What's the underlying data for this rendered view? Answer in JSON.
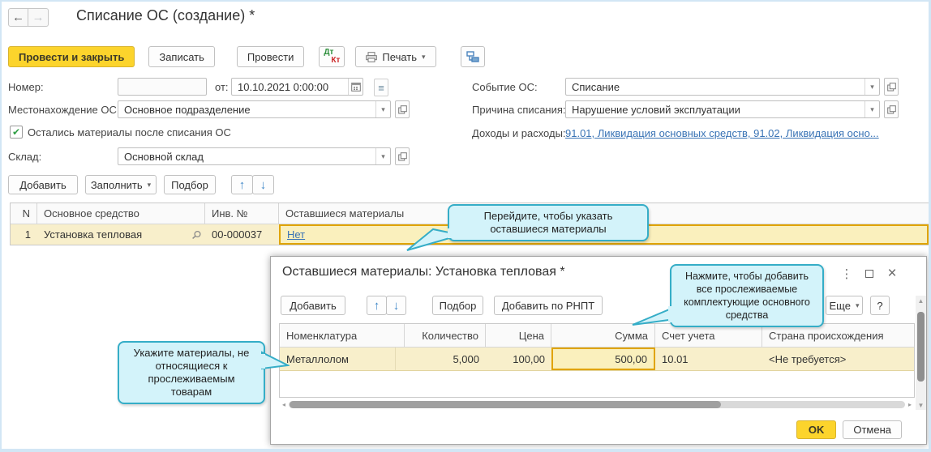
{
  "icons": {
    "back": "←",
    "forward": "→",
    "caret_down": "▾",
    "up_arrow": "↑",
    "down_arrow": "↓",
    "check": "✔",
    "dots": "⋮",
    "close": "×",
    "menu": "≡",
    "left_small": "◂",
    "right_small": "▸",
    "up_small": "▲",
    "down_small": "▼"
  },
  "window": {
    "title": "Списание ОС (создание) *"
  },
  "toolbar": {
    "post_close": "Провести и закрыть",
    "save": "Записать",
    "post": "Провести",
    "dt": "Дт",
    "kt": "Кт",
    "print": "Печать"
  },
  "form": {
    "number_label": "Номер:",
    "number_value": "",
    "date_label": "от:",
    "date_value": "10.10.2021 0:00:00",
    "location_label": "Местонахождение ОС:",
    "location_value": "Основное подразделение",
    "materials_checkbox_label": "Остались материалы после списания ОС",
    "warehouse_label": "Склад:",
    "warehouse_value": "Основной склад",
    "event_label": "Событие ОС:",
    "event_value": "Списание",
    "reason_label": "Причина списания:",
    "reason_value": "Нарушение условий эксплуатации",
    "income_label": "Доходы и расходы:",
    "income_value": "91.01, Ликвидация основных средств, 91.02, Ликвидация осно..."
  },
  "commands": {
    "add": "Добавить",
    "fill": "Заполнить",
    "pick": "Подбор"
  },
  "main_table": {
    "columns": [
      "N",
      "Основное средство",
      "Инв. №",
      "Оставшиеся материалы"
    ],
    "rows": [
      {
        "n": "1",
        "asset": "Установка тепловая",
        "inv": "00-000037",
        "materials": "Нет"
      }
    ]
  },
  "tooltips": {
    "goto": "Перейдите, чтобы указать оставшиеся материалы",
    "rnpt": "Нажмите, чтобы добавить все прослеживаемые комплектующие основного средства",
    "materials": "Укажите материалы, не относящиеся к прослеживаемым товарам"
  },
  "modal": {
    "title": "Оставшиеся материалы: Установка тепловая *",
    "commands": {
      "add": "Добавить",
      "pick": "Подбор",
      "add_rnpt": "Добавить по РНПТ",
      "more": "Еще",
      "help": "?"
    },
    "table": {
      "columns": [
        "Номенклатура",
        "Количество",
        "Цена",
        "Сумма",
        "Счет учета",
        "Страна происхождения"
      ],
      "rows": [
        {
          "nomenclature": "Металлолом",
          "qty": "5,000",
          "price": "100,00",
          "sum": "500,00",
          "account": "10.01",
          "country": "<Не требуется>"
        }
      ]
    },
    "ok": "OK",
    "cancel": "Отмена"
  },
  "colors": {
    "accent_yellow": "#fcd42c",
    "row_selection": "#f8efcb",
    "selected_cell_border": "#e0a400",
    "tooltip_bg": "#d3f3fa",
    "tooltip_border": "#35adc7",
    "link": "#3973b5",
    "arrow_blue": "#3e86c8"
  }
}
